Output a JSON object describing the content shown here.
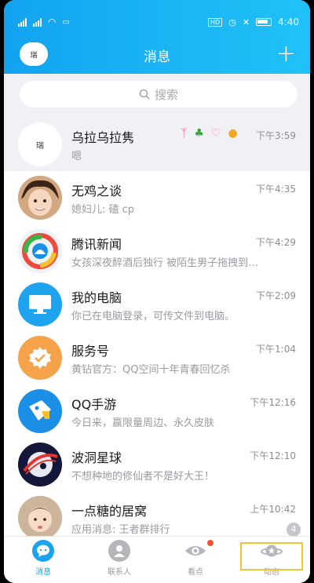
{
  "status": {
    "time": "4:40",
    "hd_label": "HD",
    "battery_label": ""
  },
  "header": {
    "avatar_text": "瑞",
    "title": "消息",
    "add_icon": "+"
  },
  "search": {
    "placeholder": "搜索"
  },
  "conversations": [
    {
      "name": "乌拉乌拉隽",
      "preview": "嗯",
      "time": "下午3:59",
      "avatar_text": "瑞"
    },
    {
      "name": "无鸡之谈",
      "preview": "媳妇儿: 磕 cp",
      "time": "下午4:35"
    },
    {
      "name": "腾讯新闻",
      "preview": "女孩深夜醉酒后独行 被陌生男子拖拽到…",
      "time": "下午4:29"
    },
    {
      "name": "我的电脑",
      "preview": "你已在电脑登录，可传文件到电脑。",
      "time": "下午2:09"
    },
    {
      "name": "服务号",
      "preview": "黄钻官方：QQ空间十年青春回忆杀",
      "time": "下午1:04"
    },
    {
      "name": "QQ手游",
      "preview": "今日来，赢限量周边、永久皮肤",
      "time": "下午12:16"
    },
    {
      "name": "波洞星球",
      "preview": "不想种地的修仙者不是好大王！",
      "time": "下午12:10"
    },
    {
      "name": "一点糖的居窝",
      "preview": "应用消息: 王者群排行",
      "time": "上午10:42",
      "unread": "4"
    }
  ],
  "tabs": [
    {
      "label": "消息"
    },
    {
      "label": "联系人"
    },
    {
      "label": "看点"
    },
    {
      "label": "动态"
    }
  ],
  "colors": {
    "accent": "#1aa4f0",
    "pinned_bg": "#f1f1f5",
    "highlight": "#f3c33a",
    "notify_dot": "#f4522b"
  }
}
